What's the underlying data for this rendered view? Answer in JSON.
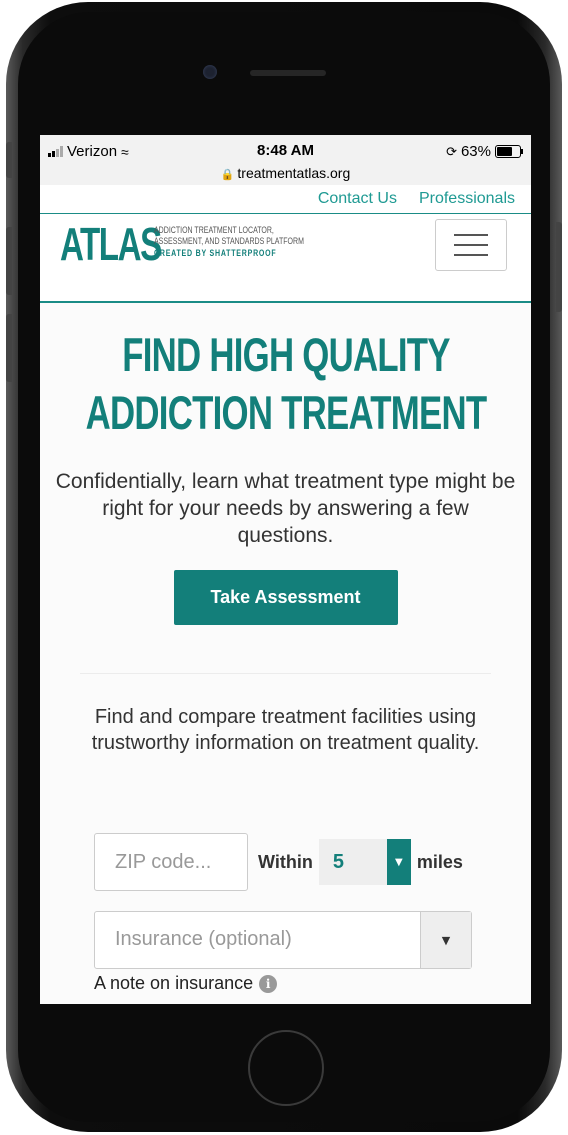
{
  "status_bar": {
    "carrier": "Verizon",
    "time": "8:48 AM",
    "battery": "63%",
    "url": "treatmentatlas.org"
  },
  "top_nav": {
    "contact": "Contact Us",
    "professionals": "Professionals"
  },
  "logo": {
    "word": "ATLAS",
    "tagline_1": "ADDICTION TREATMENT LOCATOR,",
    "tagline_2": "ASSESSMENT, AND STANDARDS PLATFORM",
    "created_by": "CREATED BY SHATTERPROOF"
  },
  "hero": {
    "title_line_1": "FIND HIGH QUALITY",
    "title_line_2": "ADDICTION TREATMENT",
    "text": "Confidentially, learn what treatment type might be right for your needs by answering a few questions.",
    "button": "Take Assessment"
  },
  "search": {
    "text": "Find and compare treatment facilities using trustworthy information on treatment quality.",
    "zip_placeholder": "ZIP code...",
    "within_label": "Within",
    "miles_value": "5",
    "miles_label": "miles",
    "insurance_placeholder": "Insurance (optional)",
    "insurance_note": "A note on insurance"
  },
  "icons": {
    "wifi": "wifi-icon",
    "lock": "lock-icon",
    "menu": "hamburger-menu-icon",
    "info": "info-icon",
    "caret": "chevron-down-icon"
  },
  "colors": {
    "brand": "#137f7a",
    "link": "#1f9a93"
  }
}
